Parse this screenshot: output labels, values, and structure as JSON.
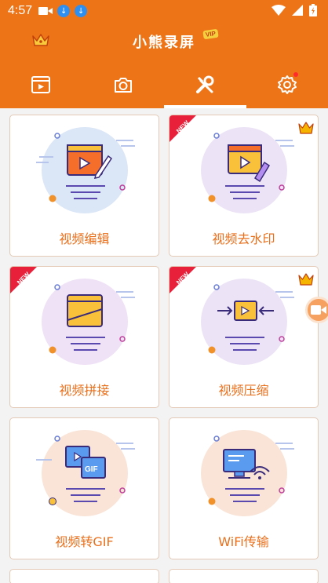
{
  "status_bar": {
    "time": "4:57"
  },
  "header": {
    "title": "小熊录屏",
    "vip_badge": "VIP"
  },
  "tabs": [
    {
      "name": "tab-recordings",
      "icon": "video-list-icon",
      "active": false
    },
    {
      "name": "tab-camera",
      "icon": "camera-icon",
      "active": false
    },
    {
      "name": "tab-tools",
      "icon": "tools-icon",
      "active": true
    },
    {
      "name": "tab-settings",
      "icon": "gear-icon",
      "active": false,
      "has_dot": true
    }
  ],
  "tools": [
    {
      "label": "视频编辑",
      "new": false,
      "vip": false,
      "bg": "#dbe6f7"
    },
    {
      "label": "视频去水印",
      "new": true,
      "vip": true,
      "bg": "#ece4f6"
    },
    {
      "label": "视频拼接",
      "new": true,
      "vip": false,
      "bg": "#efe2f6"
    },
    {
      "label": "视频压缩",
      "new": true,
      "vip": true,
      "bg": "#ece4f6"
    },
    {
      "label": "视频转GIF",
      "new": false,
      "vip": false,
      "bg": "#f9e4d7"
    },
    {
      "label": "WiFi传输",
      "new": false,
      "vip": false,
      "bg": "#f9e4d7"
    }
  ],
  "badges": {
    "new_text": "NEW"
  },
  "colors": {
    "accent": "#ee7418",
    "label": "#e96f1b",
    "new_badge": "#e8203a",
    "crown": "#f5b400"
  }
}
